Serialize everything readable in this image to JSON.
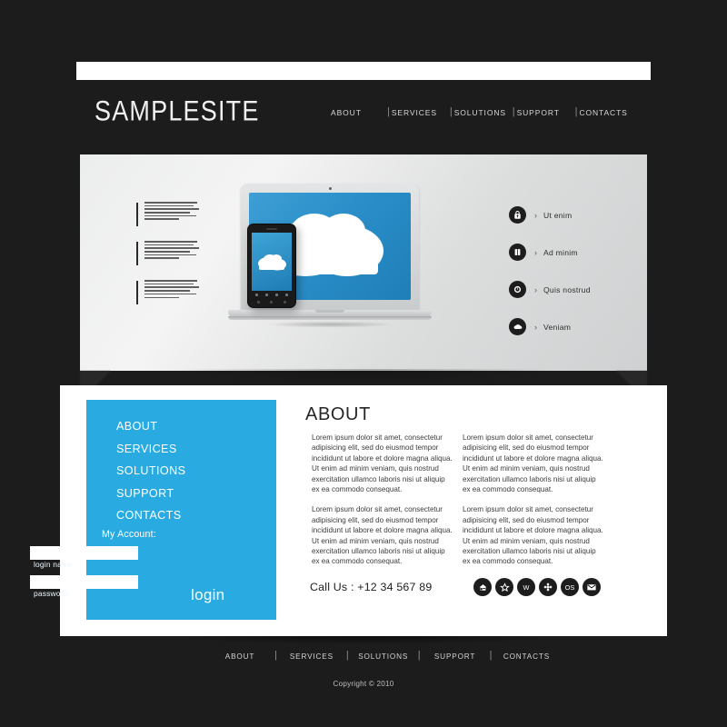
{
  "brand": {
    "logo": "SAMPLESITE"
  },
  "top_nav": {
    "items": [
      {
        "label": "ABOUT"
      },
      {
        "label": "SERVICES"
      },
      {
        "label": "SOLUTIONS"
      },
      {
        "label": "SUPPORT"
      },
      {
        "label": "CONTACTS"
      }
    ],
    "separator": "|"
  },
  "hero": {
    "snippet_count": 3,
    "snippet_lines": 6,
    "device_laptop": "laptop-with-cloud-screen",
    "device_phone": "smartphone-with-cloud-screen",
    "features": [
      {
        "icon": "lock-icon",
        "arrow": "›",
        "label": "Ut enim"
      },
      {
        "icon": "book-icon",
        "arrow": "›",
        "label": "Ad minim"
      },
      {
        "icon": "clock-icon",
        "arrow": "›",
        "label": "Quis nostrud"
      },
      {
        "icon": "cloud-icon",
        "arrow": "›",
        "label": "Veniam"
      }
    ]
  },
  "sidebar": {
    "items": [
      {
        "label": "ABOUT"
      },
      {
        "label": "SERVICES"
      },
      {
        "label": "SOLUTIONS"
      },
      {
        "label": "SUPPORT"
      },
      {
        "label": "CONTACTS"
      }
    ],
    "account_label": "My Account:",
    "login_name": {
      "value": "",
      "placeholder": "",
      "caption": "login name"
    },
    "password": {
      "value": "",
      "placeholder": "",
      "caption": "password"
    },
    "login_button": "login",
    "background_color": "#29abe2"
  },
  "about": {
    "title": "ABOUT",
    "paragraph": "Lorem ipsum dolor sit amet, consectetur adipisicing elit, sed do eiusmod tempor incididunt ut labore et dolore magna aliqua. Ut enim ad minim veniam, quis nostrud exercitation ullamco laboris nisi ut aliquip ex ea commodo consequat.",
    "columns": [
      {
        "paragraphs": [
          "p1",
          "p2"
        ]
      },
      {
        "paragraphs": [
          "p1",
          "p2"
        ]
      }
    ],
    "call_us": "Call Us : +12 34 567 89"
  },
  "socials": [
    {
      "icon": "home-icon",
      "text": ""
    },
    {
      "icon": "star-icon",
      "text": ""
    },
    {
      "icon": "w-icon",
      "text": "W"
    },
    {
      "icon": "compass-icon",
      "text": ""
    },
    {
      "icon": "os-icon",
      "text": "OS"
    },
    {
      "icon": "mail-icon",
      "text": ""
    }
  ],
  "footer": {
    "items": [
      {
        "label": "ABOUT"
      },
      {
        "label": "SERVICES"
      },
      {
        "label": "SOLUTIONS"
      },
      {
        "label": "SUPPORT"
      },
      {
        "label": "CONTACTS"
      }
    ],
    "separator": "|",
    "copyright": "Copyright © 2010"
  },
  "theme": {
    "page_background": "#1c1c1c",
    "accent": "#29abe2",
    "content_background": "#ffffff",
    "screen_blue": "#2b8ec8"
  }
}
